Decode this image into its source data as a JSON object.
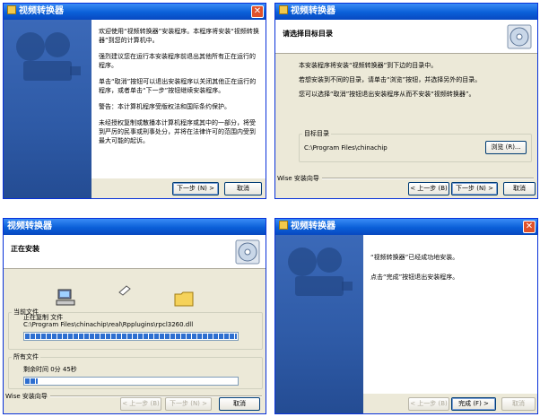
{
  "window_title": "视频转换器",
  "panel_welcome": {
    "paragraphs": [
      "欢迎使用“视频转换器”安装程序。本程序将安装“视频转换器”到您的计算机中。",
      "强烈建议您在运行本安装程序前退出其他所有正在运行的程序。",
      "单击“取消”按钮可以退出安装程序以关闭其他正在运行的程序，或者单击“下一步”按钮继续安装程序。",
      "警告：本计算机程序受版权法和国际条约保护。",
      "未经授权复制或散播本计算机程序或其中的一部分，将受到严厉的民事或刑事处分，并将在法律许可的范围内受到最大可能的起诉。"
    ],
    "next_label": "下一步 (N) >",
    "cancel_label": "取消"
  },
  "panel_dest": {
    "header": "请选择目标目录",
    "lines": [
      "本安装程序将安装“视频转换器”到下边的目录中。",
      "若想安装到不同的目录，请单击“浏览”按钮，并选择另外的目录。",
      "您可以选择“取消”按钮退出安装程序从而不安装“视频转换器”。"
    ],
    "group_label": "目标目录",
    "path": "C:\\Program Files\\chinachip",
    "browse_label": "浏览 (R)...",
    "wise_label": "Wise 安装向导",
    "back_label": "< 上一步 (B)",
    "next_label": "下一步 (N) >",
    "cancel_label": "取消"
  },
  "panel_installing": {
    "header": "正在安装",
    "current_group": "当前文件",
    "copying_label": "正在复制 文件",
    "current_file": "C:\\Program Files\\chinachip\\real\\Rpplugins\\rpcl3260.dll",
    "current_progress": 1.0,
    "all_group": "所有文件",
    "time_remaining": "剩余时间 0分 45秒",
    "all_progress": 0.06,
    "wise_label": "Wise 安装向导",
    "back_label": "< 上一步 (B)",
    "next_label": "下一步 (N) >",
    "cancel_label": "取消"
  },
  "panel_finish": {
    "line1": "“视频转换器”已经成功地安装。",
    "line2": "点击“完成”按钮退出安装程序。",
    "back_label": "< 上一步 (B)",
    "finish_label": "完成 (F) >",
    "cancel_label": "取消"
  }
}
